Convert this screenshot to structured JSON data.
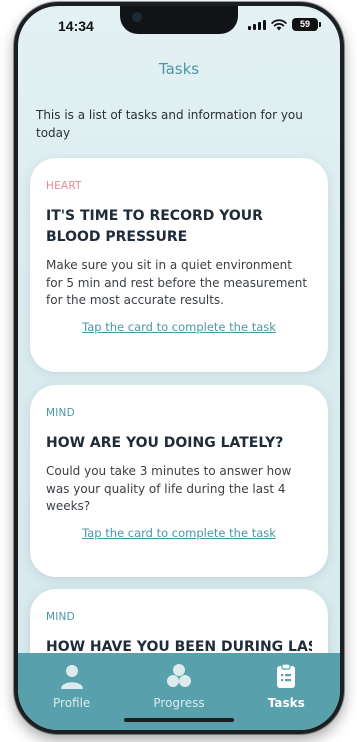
{
  "status_bar": {
    "time": "14:34",
    "battery": "59"
  },
  "header": {
    "title": "Tasks"
  },
  "intro_text": "This is a list of tasks and information for you today",
  "cards": [
    {
      "category": "HEART",
      "category_color": "#e88a95",
      "title": "IT'S TIME TO RECORD YOUR BLOOD PRESSURE",
      "description": "Make sure you sit in a quiet environment for 5 min and rest before the measurement for the most accurate results.",
      "action": "Tap the card to complete the task"
    },
    {
      "category": "MIND",
      "category_color": "#4a97a6",
      "title": "HOW ARE YOU DOING LATELY?",
      "description": "Could you take 3 minutes to answer how was your quality of life during the last 4 weeks?",
      "action": "Tap the card to complete the task"
    },
    {
      "category": "MIND",
      "category_color": "#4a97a6",
      "title": "HOW HAVE YOU BEEN DURING LAST"
    }
  ],
  "tabbar": {
    "items": [
      {
        "label": "Profile",
        "icon": "person-icon",
        "active": false
      },
      {
        "label": "Progress",
        "icon": "progress-icon",
        "active": false
      },
      {
        "label": "Tasks",
        "icon": "clipboard-icon",
        "active": true
      }
    ]
  },
  "colors": {
    "accent": "#4a97a6",
    "tabbar": "#58a0ab",
    "heart": "#e88a95"
  }
}
